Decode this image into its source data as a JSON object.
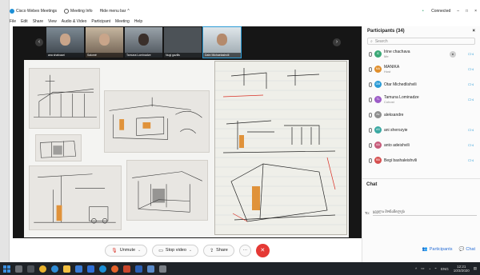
{
  "titlebar": {
    "app_title": "Cisco Webex Meetings",
    "meeting_info": "Meeting Info",
    "hide_menu": "Hide menu bar",
    "hide_menu_chevron": "^",
    "connected": "Connected",
    "connected_dot": "•",
    "minimize": "–",
    "restore": "□",
    "close": "×"
  },
  "menubar": {
    "items": [
      "File",
      "Edit",
      "Share",
      "View",
      "Audio & Video",
      "Participant",
      "Meeting",
      "Help"
    ]
  },
  "video_strip": {
    "prev_arrow": "‹",
    "next_arrow": "›",
    "thumbnails": [
      {
        "label": "ana shalvaari"
      },
      {
        "label": "Salomé"
      },
      {
        "label": "Tamuna Lominadze"
      },
      {
        "label": "Nugi gazilis"
      },
      {
        "label": "Dahr Michaelashvili"
      }
    ]
  },
  "toolbar": {
    "unmute": "Unmute",
    "stop_video": "Stop video",
    "share": "Share",
    "more": "···",
    "end": "✕",
    "dropdown": "⌄"
  },
  "participants": {
    "header": "Participants (34)",
    "close_glyph": "×",
    "search_placeholder": "Search",
    "list": [
      {
        "name": "Irine chachava",
        "role": "Me",
        "initials": "IC",
        "color": "#3aa876"
      },
      {
        "name": "MANIKA",
        "role": "Host",
        "initials": "MA",
        "color": "#e08e2b"
      },
      {
        "name": "Otar Michedlishvili",
        "role": "",
        "initials": "OM",
        "color": "#2a9bd6"
      },
      {
        "name": "Tamuna Lominadze",
        "role": "Cohost",
        "initials": "TL",
        "color": "#9c5bc7"
      },
      {
        "name": "aleksandre",
        "role": "",
        "initials": "AL",
        "color": "#8e8e8e"
      },
      {
        "name": "ani sherozyie",
        "role": "",
        "initials": "AS",
        "color": "#3aa8a2"
      },
      {
        "name": "anto adeishvili",
        "role": "",
        "initials": "AA",
        "color": "#c75b7a"
      },
      {
        "name": "Begi bashaleishvili",
        "role": "",
        "initials": "BB",
        "color": "#d65050"
      }
    ],
    "presenter_badge": "●",
    "camera_glyph": "▭◃"
  },
  "chat": {
    "header": "Chat",
    "to_label": "To:",
    "to_value": "ყველა მონაწილეს"
  },
  "panel_footer": {
    "participants_btn": "Participants",
    "chat_btn": "Chat"
  },
  "taskbar": {
    "tray_up": "^",
    "tray_icons": [
      "▭",
      "◔",
      "⌁",
      "ENG"
    ],
    "time": "12:21",
    "date": "10/3/2020",
    "notification": "▤"
  },
  "colors": {
    "accent": "#2a9bd6",
    "end_call": "#e53935",
    "stage_bg": "#161616",
    "taskbar_bg": "#1f2328"
  }
}
